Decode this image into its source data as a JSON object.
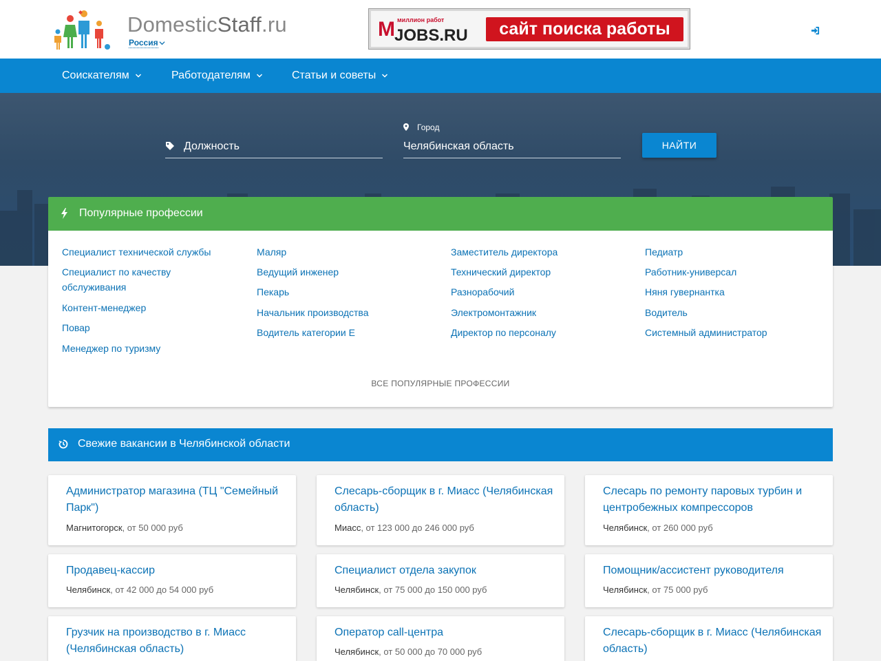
{
  "header": {
    "logo_main": "Domestic",
    "logo_bold": "Staff",
    "logo_tld": ".ru",
    "region": "Россия",
    "banner": {
      "million": "миллион работ",
      "m": "M",
      "jobs": "JOBS.RU",
      "slogan": "сайт поиска работы"
    },
    "login_icon": "sign-in-icon"
  },
  "nav": {
    "items": [
      {
        "label": "Соискателям"
      },
      {
        "label": "Работодателям"
      },
      {
        "label": "Статьи и советы"
      }
    ]
  },
  "search": {
    "position_placeholder": "Должность",
    "city_label": "Город",
    "city_value": "Челябинская область",
    "button": "НАЙТИ"
  },
  "popular": {
    "title": "Популярные профессии",
    "columns": [
      [
        "Специалист технической службы",
        "Специалист по качеству обслуживания",
        "Контент-менеджер",
        "Повар",
        "Менеджер по туризму"
      ],
      [
        "Маляр",
        "Ведущий инженер",
        "Пекарь",
        "Начальник производства",
        "Водитель категории Е"
      ],
      [
        "Заместитель директора",
        "Технический директор",
        "Разнорабочий",
        "Электромонтажник",
        "Директор по персоналу"
      ],
      [
        "Педиатр",
        "Работник-универсал",
        "Няня гувернантка",
        "Водитель",
        "Системный администратор"
      ]
    ],
    "all_link": "ВСЕ ПОПУЛЯРНЫЕ ПРОФЕССИИ"
  },
  "fresh": {
    "title": "Свежие вакансии в Челябинской области",
    "vacancies": [
      {
        "title": "Администратор магазина (ТЦ \"Семейный Парк\")",
        "city": "Магнитогорск",
        "salary": ", от 50 000 руб"
      },
      {
        "title": "Слесарь-сборщик в г. Миасс (Челябинская область)",
        "city": "Миасс",
        "salary": ", от 123 000 до 246 000 руб"
      },
      {
        "title": "Слесарь по ремонту паровых турбин и центробежных компрессоров",
        "city": "Челябинск",
        "salary": ", от 260 000 руб"
      },
      {
        "title": "Продавец-кассир",
        "city": "Челябинск",
        "salary": ", от 42 000 до 54 000 руб"
      },
      {
        "title": "Специалист отдела закупок",
        "city": "Челябинск",
        "salary": ", от 75 000 до 150 000 руб"
      },
      {
        "title": "Помощник/ассистент руководителя",
        "city": "Челябинск",
        "salary": ", от 75 000 руб"
      },
      {
        "title": "Грузчик на производство в г. Миасс (Челябинская область)",
        "city": "",
        "salary": ""
      },
      {
        "title": "Оператор call-центра",
        "city": "Челябинск",
        "salary": ", от 50 000 до 70 000 руб"
      },
      {
        "title": "Слесарь-сборщик в г. Миасс (Челябинская область)",
        "city": "",
        "salary": ""
      }
    ]
  },
  "colors": {
    "nav_blue": "#0a86d1",
    "green_header": "#4fae4e",
    "link_blue": "#0b72b5",
    "banner_red": "#d0141e"
  }
}
